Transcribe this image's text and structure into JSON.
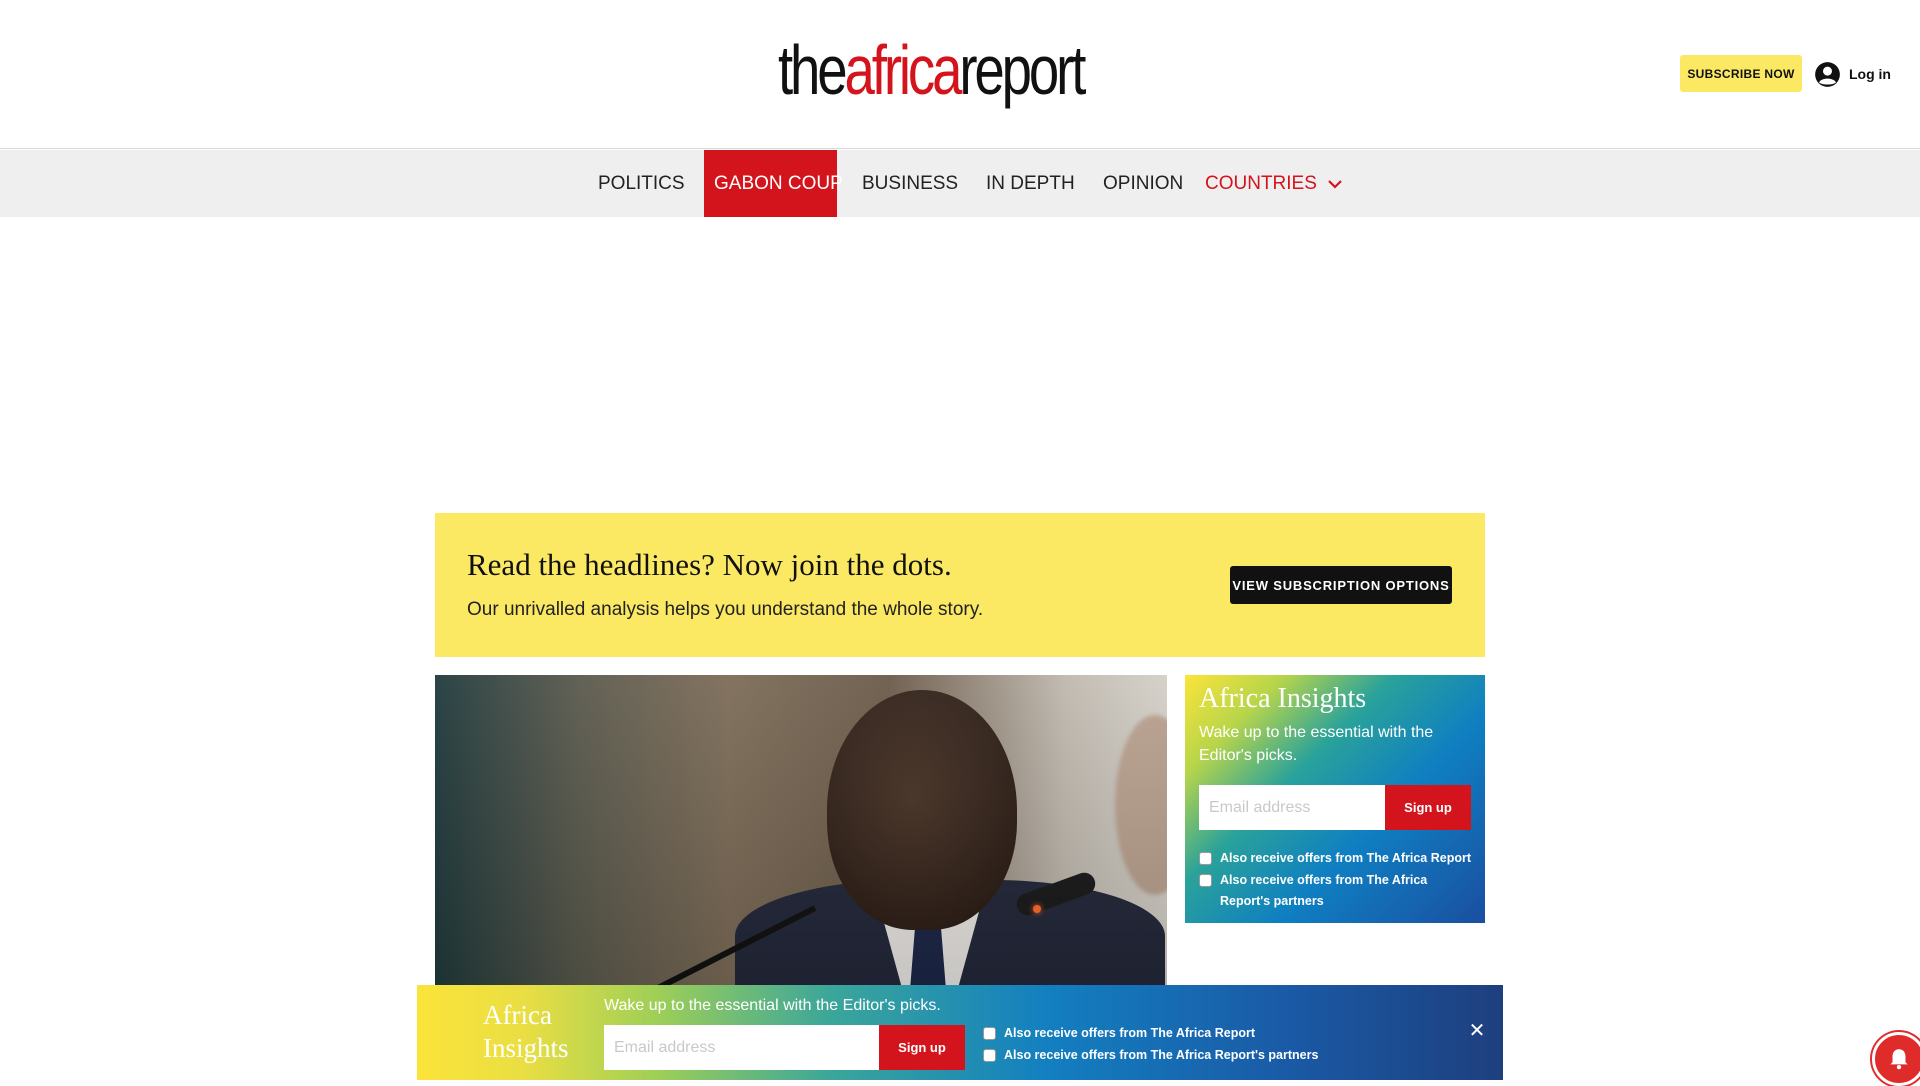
{
  "header": {
    "logo": {
      "the": "the",
      "africa": "africa",
      "report": "report"
    },
    "subscribe_label": "SUBSCRIBE NOW",
    "login_label": "Log in",
    "login_icon": "user-circle-icon"
  },
  "nav": {
    "items": [
      {
        "label": "POLITICS"
      },
      {
        "label": "GABON COUP"
      },
      {
        "label": "BUSINESS"
      },
      {
        "label": "IN DEPTH"
      },
      {
        "label": "OPINION"
      },
      {
        "label": "COUNTRIES"
      }
    ],
    "active_item": "GABON COUP",
    "dropdown_icon": "chevron-down-icon"
  },
  "promo": {
    "title": "Read the headlines? Now join the dots.",
    "subtitle": "Our unrivalled analysis helps you understand the whole story.",
    "button_label": "VIEW SUBSCRIPTION OPTIONS"
  },
  "newsletter_box": {
    "title": "Africa Insights",
    "description": "Wake up to the essential with the Editor's picks.",
    "email_placeholder": "Email address",
    "signup_label": "Sign up",
    "checks": [
      "Also receive offers from The Africa Report",
      "Also receive offers from The Africa Report's partners"
    ]
  },
  "sticky_bar": {
    "title": "Africa Insights",
    "description": "Wake up to the essential with the Editor's picks.",
    "email_placeholder": "Email address",
    "signup_label": "Sign up",
    "checks": [
      "Also receive offers from The Africa Report",
      "Also receive offers from The Africa Report's partners"
    ],
    "close_symbol": "✕"
  },
  "colors": {
    "brand_red": "#d4141c",
    "accent_yellow": "#fbe964",
    "nav_bg": "#efefef"
  }
}
